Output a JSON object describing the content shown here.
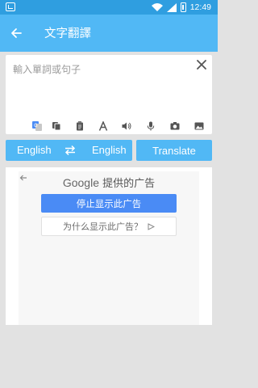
{
  "status_bar": {
    "time": "12:49",
    "icons": [
      "app-notification-icon",
      "wifi-icon",
      "signal-icon",
      "battery-icon"
    ]
  },
  "toolbar": {
    "title": "文字翻譯",
    "back_icon": "arrow-back-icon"
  },
  "input": {
    "placeholder": "輸入單詞或句子",
    "clear_icon": "close-icon",
    "tools": [
      "google-translate-icon",
      "copy-icon",
      "clipboard-icon",
      "font-icon",
      "volume-icon",
      "mic-icon",
      "camera-icon",
      "image-icon"
    ]
  },
  "language_bar": {
    "from": "English",
    "to": "English",
    "swap_icon": "swap-arrows-icon"
  },
  "translate_button": "Translate",
  "ad": {
    "brand": "Google",
    "header_suffix": " 提供的广告",
    "stop_label": "停止显示此广告",
    "why_label": "为什么显示此广告？"
  },
  "colors": {
    "status_bar": "#2f9ee0",
    "toolbar": "#51b8f5",
    "accent": "#51b8f5",
    "ad_button": "#4a8bf5",
    "background": "#e2e2e2"
  }
}
